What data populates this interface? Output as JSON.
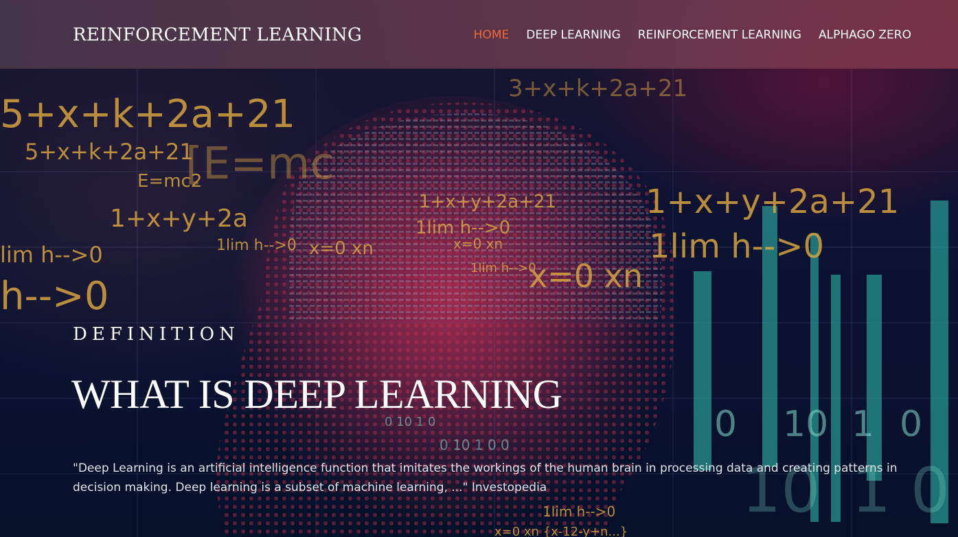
{
  "brand": "REINFORCEMENT LEARNING",
  "nav": {
    "items": [
      {
        "label": "HOME",
        "active": true
      },
      {
        "label": "DEEP LEARNING",
        "active": false
      },
      {
        "label": "REINFORCEMENT LEARNING",
        "active": false
      },
      {
        "label": "ALPHAGO ZERO",
        "active": false
      }
    ]
  },
  "hero": {
    "eyebrow": "DEFINITION",
    "title": "WHAT IS DEEP LEARNING",
    "quote": "\"Deep Learning is an artificial intelligence function that imitates the workings of the human brain in processing data and creating patterns in decision making. Deep learning is a subset of machine learning, ...\" Investopedia"
  },
  "colors": {
    "active_nav": "#f26a38",
    "formula": "#d9a441",
    "dots": "#c8304f",
    "bars": "#2fb5a5"
  }
}
